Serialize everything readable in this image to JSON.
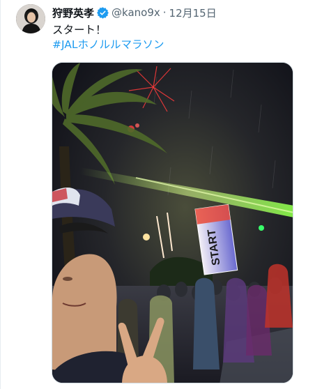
{
  "tweet": {
    "display_name": "狩野英孝",
    "handle": "@kano9x",
    "separator": "·",
    "date": "12月15日",
    "text": "スタート！",
    "hashtag": "#JALホノルルマラソン"
  },
  "media": {
    "banner_text": "START"
  },
  "icons": {
    "verified": "verified-badge-icon"
  },
  "colors": {
    "text_primary": "#0f1419",
    "text_secondary": "#536471",
    "link": "#1d9bf0",
    "verified": "#1d9bf0",
    "border": "#cfd9de"
  }
}
